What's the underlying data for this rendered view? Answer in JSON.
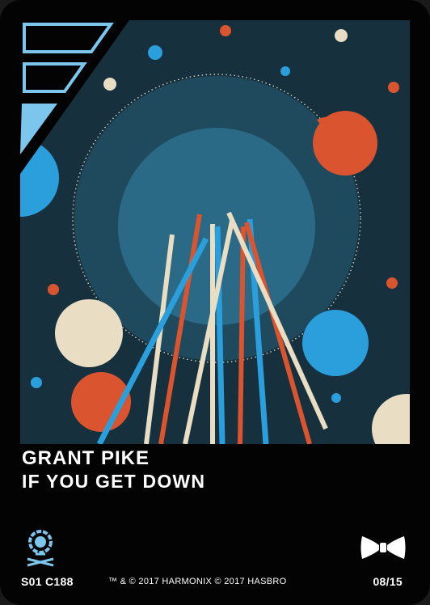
{
  "card": {
    "artist": "GRANT PIKE",
    "song": "IF YOU GET DOWN",
    "card_code": "S01 C188",
    "copyright": "™ & © 2017 HARMONIX  © 2017 HASBRO",
    "card_number": "08/15"
  },
  "icons": {
    "genre": "lantern-icon",
    "card_type": "bowtie-icon",
    "corner": "stacked-bars-logo-icon"
  },
  "colors": {
    "card_background": "#030303",
    "art_background": "#16313d",
    "inner_circle": "#2a6a86",
    "accent_red": "#d9542f",
    "accent_blue": "#2a9fdc",
    "accent_cream": "#e9ddc4",
    "icon_blue": "#7cc6ee"
  }
}
